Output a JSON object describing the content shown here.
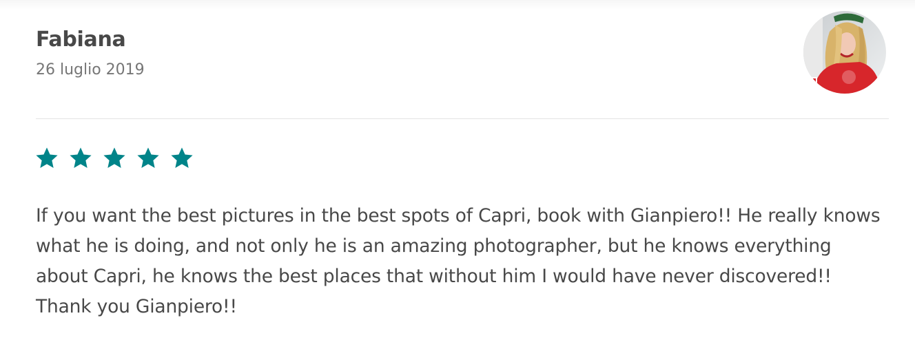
{
  "review": {
    "reviewer_name": "Fabiana",
    "date": "26 luglio 2019",
    "rating": 5,
    "max_rating": 5,
    "star_color": "#008489",
    "text": "If you want the best pictures in the best spots of Capri, book with Gianpiero!! He really knows what he is doing, and not only he is an amazing photographer, but he knows everything about Capri, he knows the best places that without him I would have never discovered!! Thank you Gianpiero!!"
  },
  "avatar": {
    "icon": "user-avatar-photo"
  }
}
